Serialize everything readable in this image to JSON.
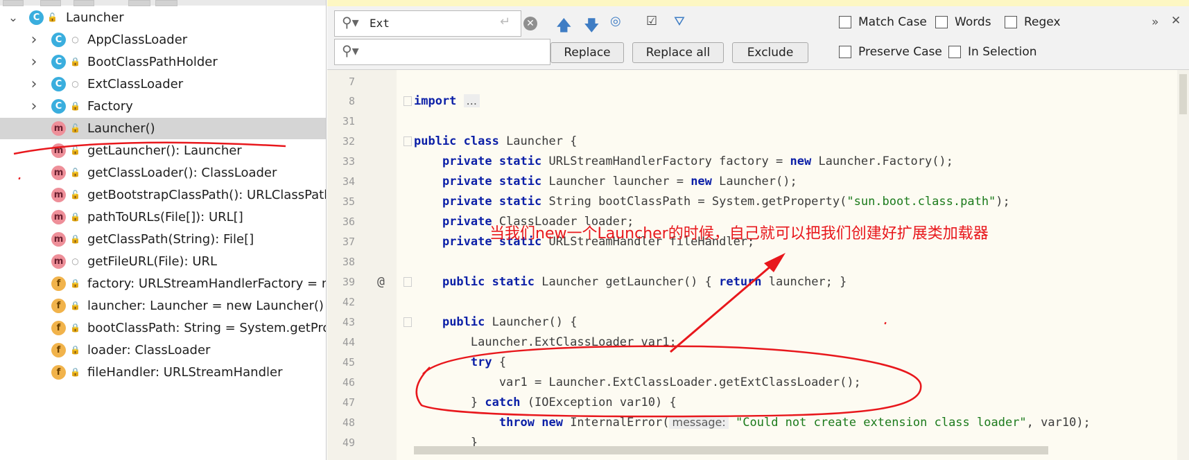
{
  "structure": {
    "root": {
      "label": "Launcher",
      "icon": "class-icon",
      "visibility": "public"
    },
    "items": [
      {
        "label": "AppClassLoader",
        "kind": "class",
        "visibility": "package",
        "expandable": true
      },
      {
        "label": "BootClassPathHolder",
        "kind": "class",
        "visibility": "private",
        "expandable": true
      },
      {
        "label": "ExtClassLoader",
        "kind": "class",
        "visibility": "package",
        "expandable": true
      },
      {
        "label": "Factory",
        "kind": "class",
        "visibility": "private",
        "expandable": true
      },
      {
        "label": "Launcher()",
        "kind": "method",
        "visibility": "public",
        "selected": true
      },
      {
        "label": "getLauncher(): Launcher",
        "kind": "method",
        "visibility": "public"
      },
      {
        "label": "getClassLoader(): ClassLoader",
        "kind": "method",
        "visibility": "public"
      },
      {
        "label": "getBootstrapClassPath(): URLClassPath",
        "kind": "method",
        "visibility": "public"
      },
      {
        "label": "pathToURLs(File[]): URL[]",
        "kind": "method",
        "visibility": "private"
      },
      {
        "label": "getClassPath(String): File[]",
        "kind": "method",
        "visibility": "private"
      },
      {
        "label": "getFileURL(File): URL",
        "kind": "method",
        "visibility": "package"
      },
      {
        "label": "factory: URLStreamHandlerFactory = new",
        "kind": "field",
        "visibility": "private"
      },
      {
        "label": "launcher: Launcher = new Launcher()",
        "kind": "field",
        "visibility": "private"
      },
      {
        "label": "bootClassPath: String = System.getProp",
        "kind": "field",
        "visibility": "private"
      },
      {
        "label": "loader: ClassLoader",
        "kind": "field",
        "visibility": "private"
      },
      {
        "label": "fileHandler: URLStreamHandler",
        "kind": "field",
        "visibility": "private"
      }
    ]
  },
  "find": {
    "search_value": "Ext",
    "replace_value": "",
    "buttons": {
      "replace": "Replace",
      "replace_all": "Replace all",
      "exclude": "Exclude"
    },
    "options": {
      "match_case": "Match Case",
      "words": "Words",
      "regex": "Regex",
      "preserve_case": "Preserve Case",
      "in_selection": "In Selection"
    },
    "toolbar": {
      "more": "»",
      "close": "✕"
    }
  },
  "editor": {
    "lines": [
      {
        "n": "7",
        "tokens": []
      },
      {
        "n": "8",
        "tokens": [
          {
            "t": "import",
            "c": "kw"
          },
          {
            "t": " "
          },
          {
            "t": "...",
            "c": "hint"
          }
        ]
      },
      {
        "n": "31",
        "tokens": []
      },
      {
        "n": "32",
        "tokens": [
          {
            "t": "public class",
            "c": "kw"
          },
          {
            "t": " Launcher {"
          }
        ]
      },
      {
        "n": "33",
        "tokens": [
          {
            "t": "    "
          },
          {
            "t": "private static",
            "c": "kw"
          },
          {
            "t": " URLStreamHandlerFactory factory = "
          },
          {
            "t": "new",
            "c": "kw"
          },
          {
            "t": " Launcher.Factory();"
          }
        ]
      },
      {
        "n": "34",
        "tokens": [
          {
            "t": "    "
          },
          {
            "t": "private static",
            "c": "kw"
          },
          {
            "t": " Launcher launcher = "
          },
          {
            "t": "new",
            "c": "kw"
          },
          {
            "t": " Launcher();"
          }
        ]
      },
      {
        "n": "35",
        "tokens": [
          {
            "t": "    "
          },
          {
            "t": "private static",
            "c": "kw"
          },
          {
            "t": " String bootClassPath = System.getProperty("
          },
          {
            "t": "\"sun.boot.class.path\"",
            "c": "str"
          },
          {
            "t": ");"
          }
        ]
      },
      {
        "n": "36",
        "tokens": [
          {
            "t": "    "
          },
          {
            "t": "private",
            "c": "kw"
          },
          {
            "t": " ClassLoader loader;"
          }
        ]
      },
      {
        "n": "37",
        "tokens": [
          {
            "t": "    "
          },
          {
            "t": "private static",
            "c": "kw"
          },
          {
            "t": " URLStreamHandler fileHandler;"
          }
        ]
      },
      {
        "n": "38",
        "tokens": []
      },
      {
        "n": "39",
        "tokens": [
          {
            "t": "    "
          },
          {
            "t": "public static",
            "c": "kw"
          },
          {
            "t": " Launcher getLauncher() { "
          },
          {
            "t": "return",
            "c": "kw"
          },
          {
            "t": " launcher; }"
          }
        ]
      },
      {
        "n": "42",
        "tokens": []
      },
      {
        "n": "43",
        "tokens": [
          {
            "t": "    "
          },
          {
            "t": "public",
            "c": "kw"
          },
          {
            "t": " Launcher() {"
          }
        ]
      },
      {
        "n": "44",
        "tokens": [
          {
            "t": "        Launcher.ExtClassLoader var1;"
          }
        ]
      },
      {
        "n": "45",
        "tokens": [
          {
            "t": "        "
          },
          {
            "t": "try",
            "c": "kw"
          },
          {
            "t": " {"
          }
        ]
      },
      {
        "n": "46",
        "tokens": [
          {
            "t": "            var1 = Launcher.ExtClassLoader.getExtClassLoader();"
          }
        ]
      },
      {
        "n": "47",
        "tokens": [
          {
            "t": "        } "
          },
          {
            "t": "catch",
            "c": "kw"
          },
          {
            "t": " (IOException var10) {"
          }
        ]
      },
      {
        "n": "48",
        "tokens": [
          {
            "t": "            "
          },
          {
            "t": "throw new",
            "c": "kw"
          },
          {
            "t": " InternalError("
          },
          {
            "t": "message:",
            "c": "hint"
          },
          {
            "t": " "
          },
          {
            "t": "\"Could not create extension class loader\"",
            "c": "str"
          },
          {
            "t": ", var10);"
          }
        ]
      },
      {
        "n": "49",
        "tokens": [
          {
            "t": "        }"
          }
        ]
      }
    ]
  },
  "annotation": {
    "callout": "当我们new一个Launcher的时候，自己就可以把我们创建好扩展类加载器",
    "color": "#e8171c"
  }
}
